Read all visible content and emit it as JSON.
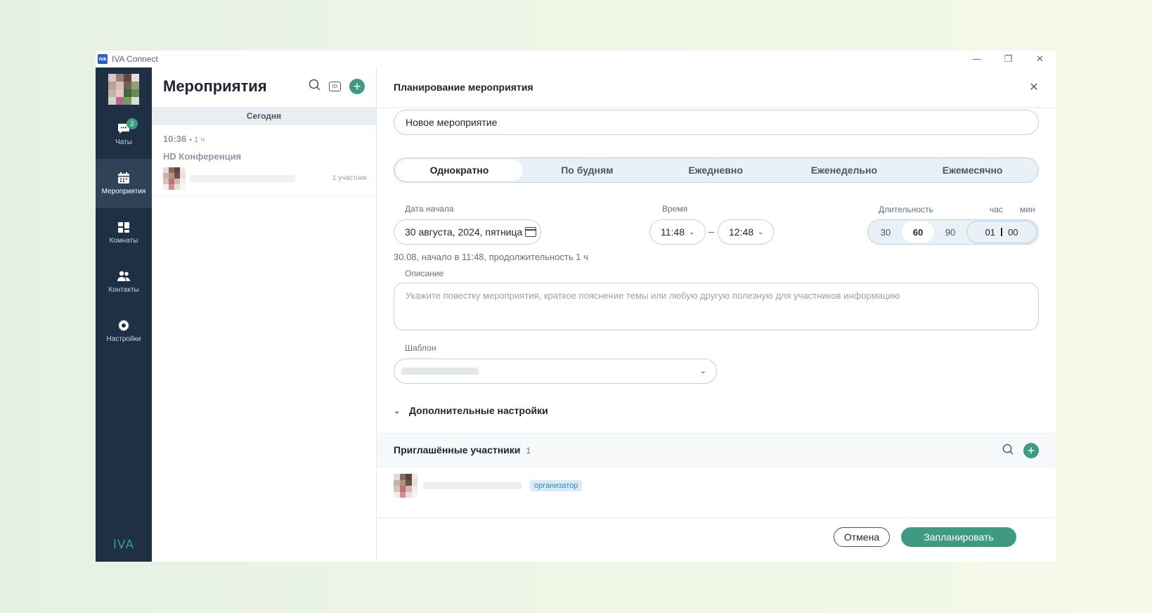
{
  "window": {
    "title": "IVA Connect",
    "logo_text": "IVA",
    "minimize": "—",
    "restore": "❐",
    "close": "✕"
  },
  "rail": {
    "items": [
      {
        "label": "Чаты",
        "icon": "chat-icon",
        "badge": "2"
      },
      {
        "label": "Мероприятия",
        "icon": "calendar-icon",
        "active": true
      },
      {
        "label": "Комнаты",
        "icon": "rooms-icon"
      },
      {
        "label": "Контакты",
        "icon": "contacts-icon"
      },
      {
        "label": "Настройки",
        "icon": "gear-icon"
      }
    ],
    "logo": "IVA"
  },
  "events": {
    "title": "Мероприятия",
    "id_label": "ID",
    "today": "Сегодня",
    "card": {
      "time": "10:36",
      "duration": "• 1 ч",
      "name": "HD Конференция",
      "participants": "1 участник"
    }
  },
  "planner": {
    "title": "Планирование мероприятия",
    "name_value": "Новое мероприятие",
    "recurrence": [
      "Однократно",
      "По будням",
      "Ежедневно",
      "Еженедельно",
      "Ежемесячно"
    ],
    "start_date_label": "Дата начала",
    "start_date_value": "30 августа, 2024, пятница",
    "time_label": "Время",
    "time_from": "11:48",
    "time_dash": "–",
    "time_to": "12:48",
    "duration_label": "Длительность",
    "hour_label": "час",
    "min_label": "мин",
    "duration_options": [
      "30",
      "60",
      "90"
    ],
    "duration_selected": "60",
    "duration_hours": "01",
    "duration_minutes": "00",
    "summary": "30.08, начало в 11:48, продолжительность 1 ч",
    "description_label": "Описание",
    "description_placeholder": "Укажите повестку мероприятия, краткое пояснение темы или любую другую полезную для участников информацию",
    "template_label": "Шаблон",
    "more_settings": "Дополнительные настройки",
    "invited_title": "Приглашённые участники",
    "invited_count": "1",
    "organizer_badge": "организатор",
    "cancel": "Отмена",
    "schedule": "Запланировать"
  },
  "colors": {
    "accent": "#3e9b82",
    "rail": "#1f3044",
    "annotation_arrow": "#21a548"
  }
}
